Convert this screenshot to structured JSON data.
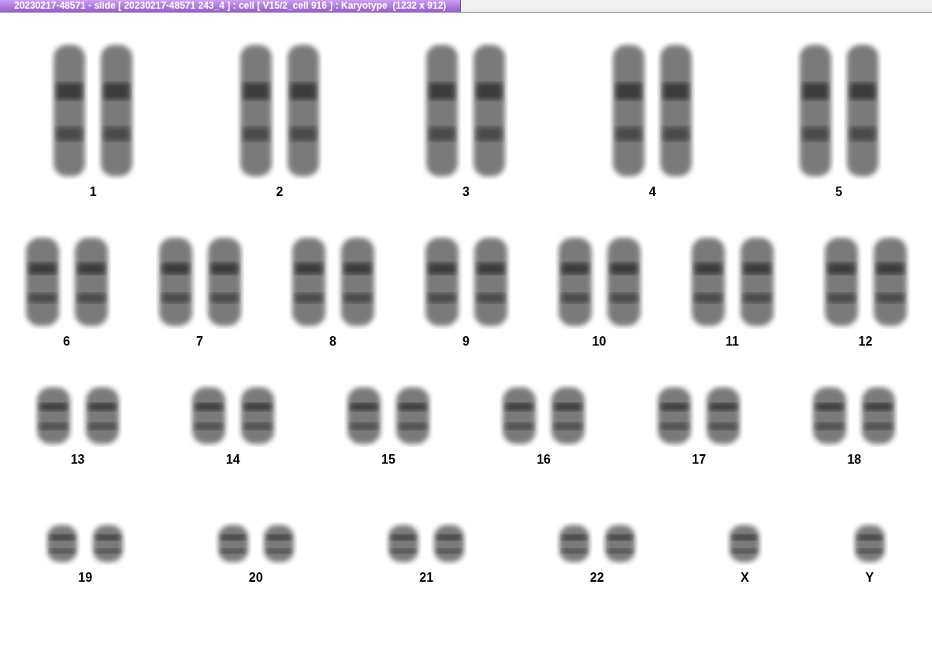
{
  "window": {
    "title": "20230217-48571 - slide [ 20230217-48571 243_4 ] : cell [ V15/2_cell 916 ] : Karyotype  (1232 x 912)"
  },
  "karyotype": {
    "rows": [
      {
        "items": [
          {
            "label": "1",
            "kind": "pair"
          },
          {
            "label": "2",
            "kind": "pair"
          },
          {
            "label": "3",
            "kind": "pair"
          },
          {
            "label": "4",
            "kind": "pair"
          },
          {
            "label": "5",
            "kind": "pair"
          }
        ]
      },
      {
        "items": [
          {
            "label": "6",
            "kind": "pair"
          },
          {
            "label": "7",
            "kind": "pair"
          },
          {
            "label": "8",
            "kind": "pair"
          },
          {
            "label": "9",
            "kind": "pair"
          },
          {
            "label": "10",
            "kind": "pair"
          },
          {
            "label": "11",
            "kind": "pair"
          },
          {
            "label": "12",
            "kind": "pair"
          }
        ]
      },
      {
        "items": [
          {
            "label": "13",
            "kind": "pair"
          },
          {
            "label": "14",
            "kind": "pair"
          },
          {
            "label": "15",
            "kind": "pair"
          },
          {
            "label": "16",
            "kind": "pair"
          },
          {
            "label": "17",
            "kind": "pair"
          },
          {
            "label": "18",
            "kind": "pair"
          }
        ]
      },
      {
        "items": [
          {
            "label": "19",
            "kind": "pair"
          },
          {
            "label": "20",
            "kind": "pair"
          },
          {
            "label": "21",
            "kind": "pair"
          },
          {
            "label": "22",
            "kind": "pair"
          },
          {
            "label": "X",
            "kind": "single"
          },
          {
            "label": "Y",
            "kind": "single"
          }
        ]
      }
    ]
  }
}
